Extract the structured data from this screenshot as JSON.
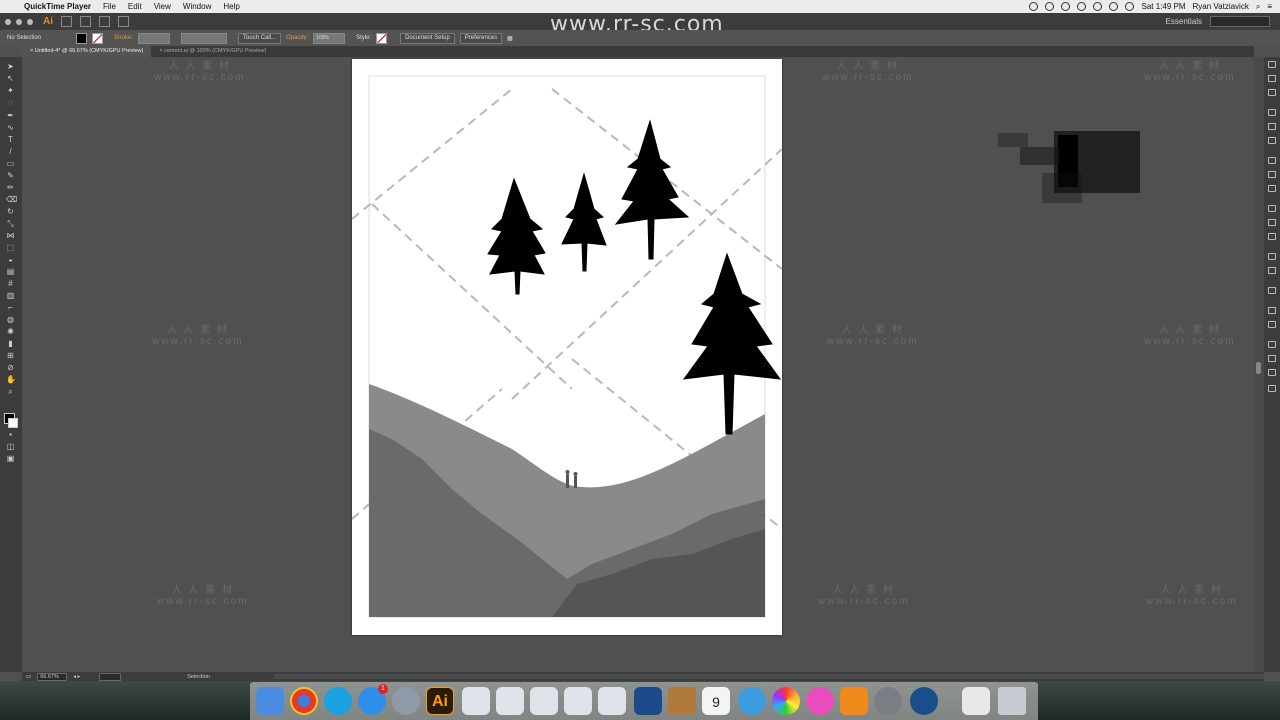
{
  "menubar": {
    "app_name": "QuickTime Player",
    "menus": [
      "File",
      "Edit",
      "View",
      "Window",
      "Help"
    ],
    "clock": "Sat 1:49 PM",
    "user": "Ryan Vatziavick"
  },
  "appbar": {
    "app_logo": "Ai",
    "workspace": "Essentials",
    "watermark": "www.rr-sc.com"
  },
  "controlbar": {
    "selection": "No Selection",
    "stroke_label": "Stroke:",
    "brush": "Touch Call...",
    "opacity_label": "Opacity:",
    "opacity_value": "100%",
    "style_label": "Style:",
    "document_setup": "Document Setup",
    "preferences": "Preferences"
  },
  "tabs": [
    {
      "label": "Untitled-4* @ 66.67% (CMYK/GPU Preview)"
    },
    {
      "label": "cement.ai @ 100% (CMYK/GPU Preview)"
    }
  ],
  "statusbar": {
    "zoom": "66.67%",
    "mode": "Selection"
  },
  "watermark_cn": "人 人 素 材",
  "watermark_url": "www.rr-sc.com",
  "dock": {
    "calendar_day": "9",
    "notification_badge": "1"
  },
  "colors": {
    "menubar_bg": "#ececec",
    "app_bg": "#3c3c3c",
    "canvas_bg": "#505050",
    "artboard": "#ffffff",
    "hill_light": "#8a8a8a",
    "hill_dark": "#5e5e5e",
    "illustrator_orange": "#e08a2a"
  }
}
